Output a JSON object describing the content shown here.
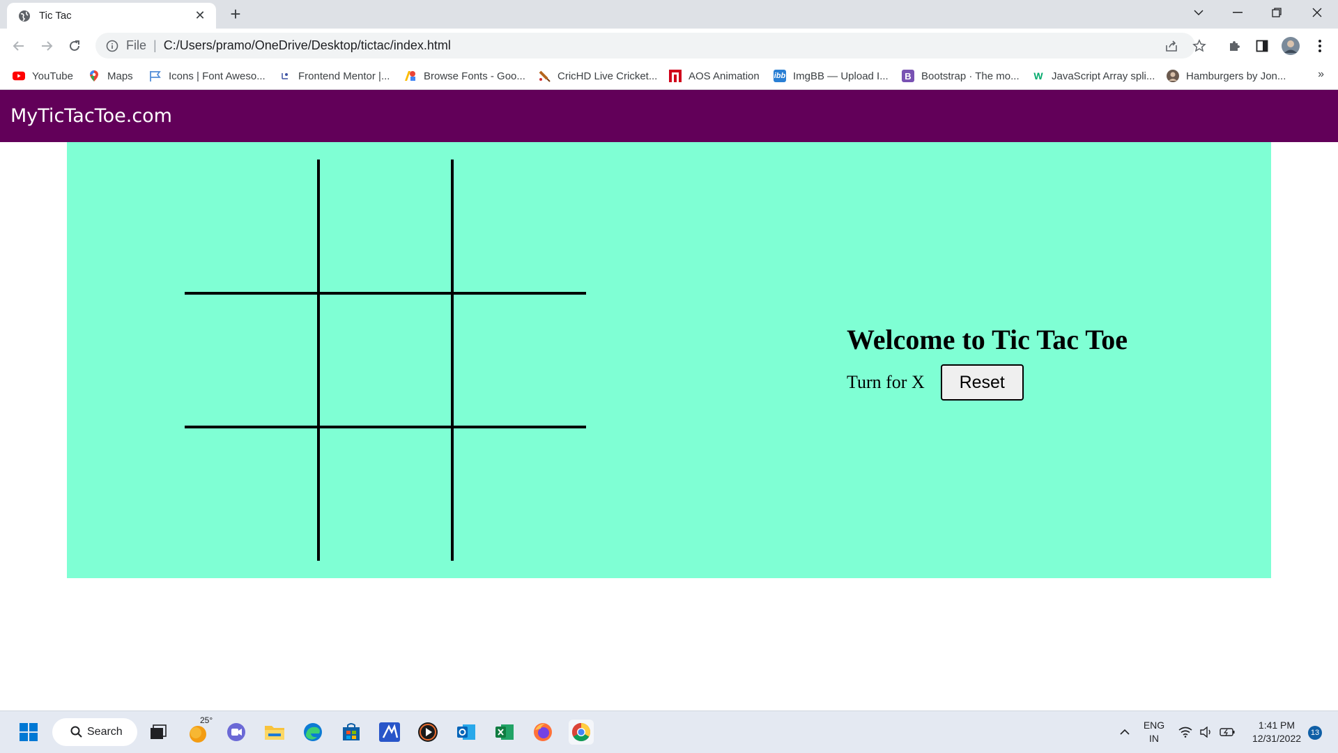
{
  "browser": {
    "tab_title": "Tic Tac",
    "new_tab_symbol": "+",
    "address_scheme_label": "File",
    "address_path": "C:/Users/pramo/OneDrive/Desktop/tictac/index.html",
    "bookmarks": [
      {
        "label": "YouTube",
        "icon": "youtube-icon",
        "color": "#ff0000"
      },
      {
        "label": "Maps",
        "icon": "maps-pin-icon",
        "color": "#34a853"
      },
      {
        "label": "Icons | Font Aweso...",
        "icon": "flag-icon",
        "color": "#528dd7"
      },
      {
        "label": "Frontend Mentor |...",
        "icon": "frontend-mentor-icon",
        "color": "#3e54a3"
      },
      {
        "label": "Browse Fonts - Goo...",
        "icon": "google-fonts-icon",
        "color": "#4285f4"
      },
      {
        "label": "CricHD Live Cricket...",
        "icon": "cricket-bat-icon",
        "color": "#b5651d"
      },
      {
        "label": "AOS Animation",
        "icon": "aos-icon",
        "color": "#d0021b"
      },
      {
        "label": "ImgBB — Upload I...",
        "icon": "imgbb-icon",
        "color": "#2a7fd4"
      },
      {
        "label": "Bootstrap · The mo...",
        "icon": "bootstrap-icon",
        "color": "#7952b3"
      },
      {
        "label": "JavaScript Array spli...",
        "icon": "w3schools-icon",
        "color": "#04aa6d"
      },
      {
        "label": "Hamburgers by Jon...",
        "icon": "avatar-icon",
        "color": "#6b5a4e"
      }
    ],
    "more_bookmarks_symbol": "»"
  },
  "page": {
    "site_title": "MyTicTacToe.com",
    "heading": "Welcome to Tic Tac Toe",
    "turn_text": "Turn for X",
    "reset_label": "Reset",
    "colors": {
      "header": "#620059",
      "game_bg": "#7fffd4"
    }
  },
  "board": {
    "rows": 3,
    "cols": 3,
    "cells": [
      "",
      "",
      "",
      "",
      "",
      "",
      "",
      "",
      ""
    ]
  },
  "taskbar": {
    "search_label": "Search",
    "weather_temp": "25°",
    "language": "ENG",
    "region": "IN",
    "time": "1:41 PM",
    "date": "12/31/2022",
    "notification_count": "13"
  }
}
